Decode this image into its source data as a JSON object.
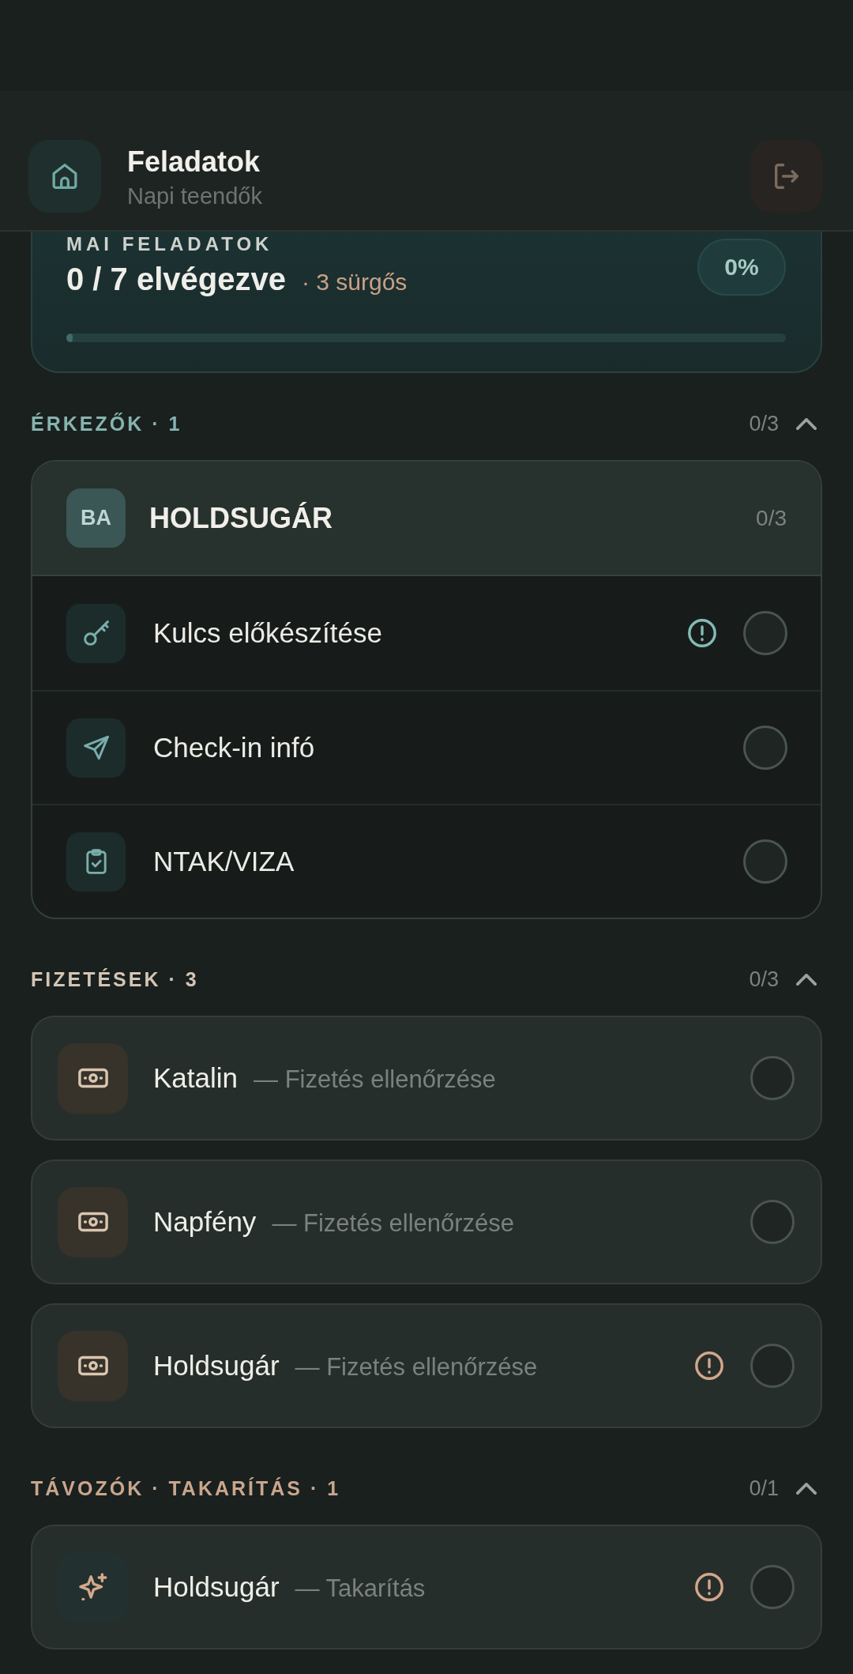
{
  "header": {
    "title": "Feladatok",
    "subtitle": "Napi teendők"
  },
  "summary": {
    "label": "MAI FELADATOK",
    "done": "0 / 7 elvégezve",
    "urgent": "· 3 sürgős",
    "percent": "0%",
    "level": 0
  },
  "sections": [
    {
      "kind": "arrivals",
      "title": "ÉRKEZŐK · 1",
      "color": "#86b3b0",
      "count": "0/3",
      "expanded": true,
      "groups": [
        {
          "initials": "BA",
          "name": "HOLDSUGÁR",
          "count": "0/3",
          "tasks": [
            {
              "kind": "key",
              "label": "Kulcs előkészítése",
              "urgent": true,
              "checked": false
            },
            {
              "kind": "checkin",
              "label": "Check-in infó",
              "urgent": false,
              "checked": false
            },
            {
              "kind": "registration",
              "label": "NTAK/VIZA",
              "urgent": false,
              "checked": false
            }
          ]
        }
      ]
    },
    {
      "kind": "payments",
      "title": "FIZETÉSEK · 3",
      "color": "#d3c5b5",
      "count": "0/3",
      "expanded": true,
      "items": [
        {
          "kind": "payment",
          "name": "Katalin",
          "detail": "— Fizetés ellenőrzése",
          "urgent": false,
          "checked": false
        },
        {
          "kind": "payment",
          "name": "Napfény",
          "detail": "— Fizetés ellenőrzése",
          "urgent": false,
          "checked": false
        },
        {
          "kind": "payment",
          "name": "Holdsugár",
          "detail": "— Fizetés ellenőrzése",
          "urgent": true,
          "checked": false
        }
      ]
    },
    {
      "kind": "departures",
      "title": "TÁVOZÓK · TAKARÍTÁS · 1",
      "color": "#c9a68e",
      "count": "0/1",
      "expanded": true,
      "items": [
        {
          "kind": "cleaning",
          "name": "Holdsugár",
          "detail": "— Takarítás",
          "urgent": true,
          "checked": false
        }
      ]
    }
  ]
}
